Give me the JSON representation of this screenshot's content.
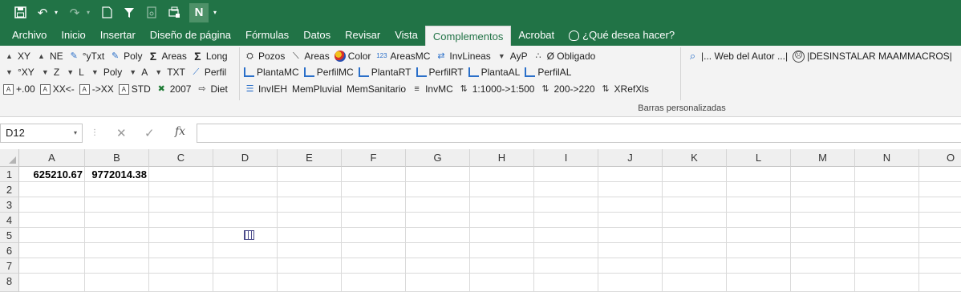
{
  "quick_access": {
    "n_label": "N"
  },
  "tabs": [
    {
      "label": "Archivo"
    },
    {
      "label": "Inicio"
    },
    {
      "label": "Insertar"
    },
    {
      "label": "Diseño de página"
    },
    {
      "label": "Fórmulas"
    },
    {
      "label": "Datos"
    },
    {
      "label": "Revisar"
    },
    {
      "label": "Vista"
    },
    {
      "label": "Complementos"
    },
    {
      "label": "Acrobat"
    }
  ],
  "tell_me": "¿Qué desea hacer?",
  "ribbon": {
    "row1": [
      "XY",
      "NE",
      "°yTxt",
      "Poly",
      "Areas",
      "Long"
    ],
    "row2": [
      "°XY",
      "Z",
      "L",
      "Poly",
      "A",
      "TXT",
      "Perfil"
    ],
    "row3": [
      "+.00",
      "XX<-",
      "->XX",
      "STD",
      "2007",
      "Diet"
    ],
    "col2_row1": [
      "Pozos",
      "Areas",
      "Color",
      "AreasMC",
      "InvLineas",
      "AyP",
      "Ø Obligado"
    ],
    "col2_row2": [
      "PlantaMC",
      "PerfilMC",
      "PlantaRT",
      "PerfilRT",
      "PlantaAL",
      "PerfilAL"
    ],
    "col2_row3": [
      "InvIEH",
      "MemPluvial",
      "MemSanitario",
      "InvMC",
      "1:1000->1:500",
      "200->220",
      "XRefXls"
    ],
    "web_author": "|... Web del Autor ...|",
    "uninstall": "|DESINSTALAR MAAMMACROS|",
    "group_label": "Barras personalizadas"
  },
  "formula_bar": {
    "name_box": "D12",
    "fx": "fx",
    "value": ""
  },
  "columns": [
    "A",
    "B",
    "C",
    "D",
    "E",
    "F",
    "G",
    "H",
    "I",
    "J",
    "K",
    "L",
    "M",
    "N",
    "O"
  ],
  "rows": [
    "1",
    "2",
    "3",
    "4",
    "5",
    "6",
    "7",
    "8"
  ],
  "cells": {
    "A1": "625210.67",
    "B1": "9772014.38"
  }
}
